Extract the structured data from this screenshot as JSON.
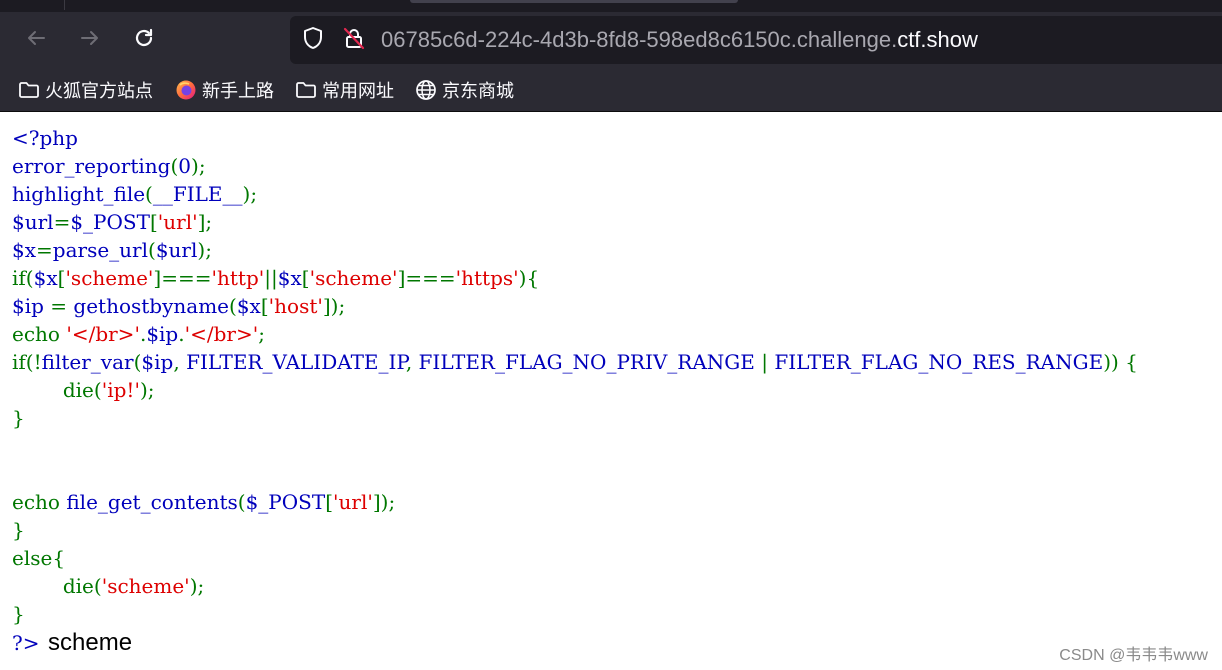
{
  "browser": {
    "url_prefix": "06785c6d-224c-4d3b-8fd8-598ed8c6150c.challenge.",
    "url_domain": "ctf.show",
    "icons": {
      "back": "arrow-left-icon",
      "forward": "arrow-right-icon",
      "reload": "reload-icon",
      "tracking": "shield-icon",
      "security": "insecure-lock-icon"
    }
  },
  "bookmarks": [
    {
      "label": "火狐官方站点",
      "icon": "folder-icon"
    },
    {
      "label": "新手上路",
      "icon": "firefox-icon"
    },
    {
      "label": "常用网址",
      "icon": "folder-icon"
    },
    {
      "label": "京东商城",
      "icon": "globe-icon"
    }
  ],
  "code": [
    [
      {
        "c": "d",
        "t": "<?php"
      }
    ],
    [
      {
        "c": "d",
        "t": "error_reporting"
      },
      {
        "c": "k",
        "t": "("
      },
      {
        "c": "d",
        "t": "0"
      },
      {
        "c": "k",
        "t": ");"
      }
    ],
    [
      {
        "c": "d",
        "t": "highlight_file"
      },
      {
        "c": "k",
        "t": "("
      },
      {
        "c": "d",
        "t": "__FILE__"
      },
      {
        "c": "k",
        "t": ");"
      }
    ],
    [
      {
        "c": "d",
        "t": "$url"
      },
      {
        "c": "k",
        "t": "="
      },
      {
        "c": "d",
        "t": "$_POST"
      },
      {
        "c": "k",
        "t": "["
      },
      {
        "c": "s",
        "t": "'url'"
      },
      {
        "c": "k",
        "t": "];"
      }
    ],
    [
      {
        "c": "d",
        "t": "$x"
      },
      {
        "c": "k",
        "t": "="
      },
      {
        "c": "d",
        "t": "parse_url"
      },
      {
        "c": "k",
        "t": "("
      },
      {
        "c": "d",
        "t": "$url"
      },
      {
        "c": "k",
        "t": ");"
      }
    ],
    [
      {
        "c": "k",
        "t": "if("
      },
      {
        "c": "d",
        "t": "$x"
      },
      {
        "c": "k",
        "t": "["
      },
      {
        "c": "s",
        "t": "'scheme'"
      },
      {
        "c": "k",
        "t": "]==="
      },
      {
        "c": "s",
        "t": "'http'"
      },
      {
        "c": "k",
        "t": "||"
      },
      {
        "c": "d",
        "t": "$x"
      },
      {
        "c": "k",
        "t": "["
      },
      {
        "c": "s",
        "t": "'scheme'"
      },
      {
        "c": "k",
        "t": "]==="
      },
      {
        "c": "s",
        "t": "'https'"
      },
      {
        "c": "k",
        "t": "){"
      }
    ],
    [
      {
        "c": "d",
        "t": "$ip "
      },
      {
        "c": "k",
        "t": "= "
      },
      {
        "c": "d",
        "t": "gethostbyname"
      },
      {
        "c": "k",
        "t": "("
      },
      {
        "c": "d",
        "t": "$x"
      },
      {
        "c": "k",
        "t": "["
      },
      {
        "c": "s",
        "t": "'host'"
      },
      {
        "c": "k",
        "t": "]);"
      }
    ],
    [
      {
        "c": "k",
        "t": "echo "
      },
      {
        "c": "s",
        "t": "'</br>'"
      },
      {
        "c": "k",
        "t": "."
      },
      {
        "c": "d",
        "t": "$ip"
      },
      {
        "c": "k",
        "t": "."
      },
      {
        "c": "s",
        "t": "'</br>'"
      },
      {
        "c": "k",
        "t": ";"
      }
    ],
    [
      {
        "c": "k",
        "t": "if(!"
      },
      {
        "c": "d",
        "t": "filter_var"
      },
      {
        "c": "k",
        "t": "("
      },
      {
        "c": "d",
        "t": "$ip"
      },
      {
        "c": "k",
        "t": ", "
      },
      {
        "c": "d",
        "t": "FILTER_VALIDATE_IP"
      },
      {
        "c": "k",
        "t": ", "
      },
      {
        "c": "d",
        "t": "FILTER_FLAG_NO_PRIV_RANGE "
      },
      {
        "c": "k",
        "t": "| "
      },
      {
        "c": "d",
        "t": "FILTER_FLAG_NO_RES_RANGE"
      },
      {
        "c": "k",
        "t": ")) {"
      }
    ],
    [
      {
        "c": "k",
        "t": "        "
      },
      {
        "c": "k",
        "t": "die("
      },
      {
        "c": "s",
        "t": "'ip!'"
      },
      {
        "c": "k",
        "t": ");"
      }
    ],
    [
      {
        "c": "k",
        "t": "}"
      }
    ],
    [],
    [],
    [
      {
        "c": "k",
        "t": "echo "
      },
      {
        "c": "d",
        "t": "file_get_contents"
      },
      {
        "c": "k",
        "t": "("
      },
      {
        "c": "d",
        "t": "$_POST"
      },
      {
        "c": "k",
        "t": "["
      },
      {
        "c": "s",
        "t": "'url'"
      },
      {
        "c": "k",
        "t": "]);"
      }
    ],
    [
      {
        "c": "k",
        "t": "}"
      }
    ],
    [
      {
        "c": "k",
        "t": "else{"
      }
    ],
    [
      {
        "c": "k",
        "t": "        die("
      },
      {
        "c": "s",
        "t": "'scheme'"
      },
      {
        "c": "k",
        "t": ");"
      }
    ],
    [
      {
        "c": "k",
        "t": "}"
      }
    ]
  ],
  "output": {
    "php_close": "?>",
    "text": "scheme"
  },
  "watermark": "CSDN @韦韦韦www"
}
